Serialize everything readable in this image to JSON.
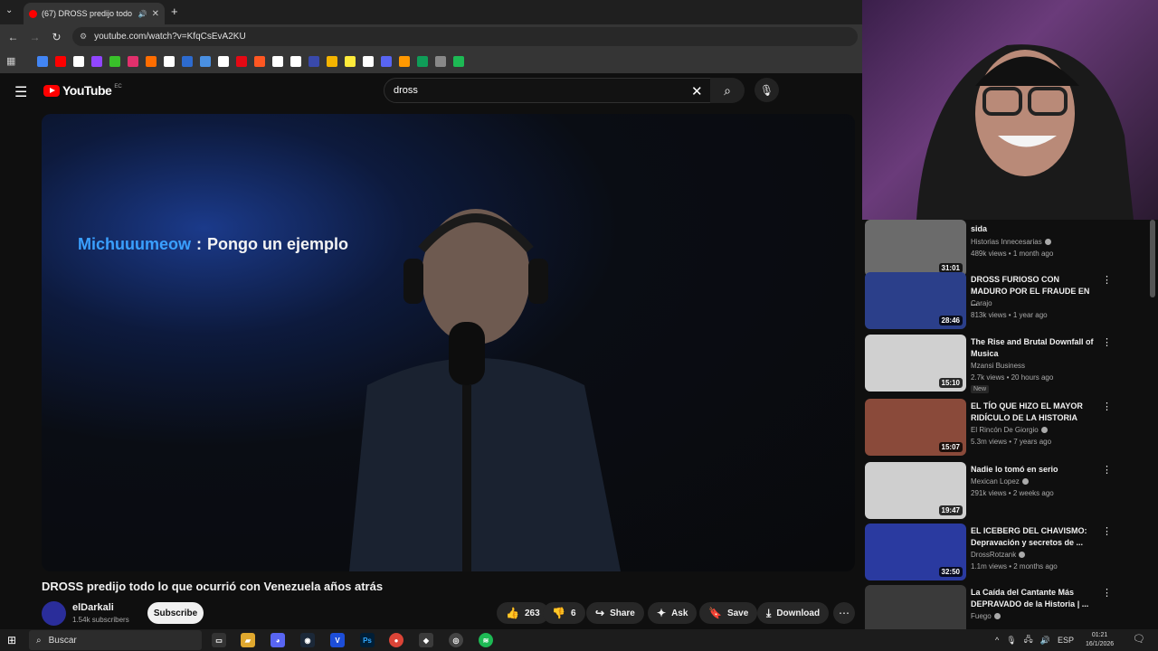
{
  "browser": {
    "tab_title": "(67) DROSS predijo todo lo",
    "url": "youtube.com/watch?v=KfqCsEvA2KU",
    "bookmark_colors": [
      "#4285f4",
      "#ff0000",
      "#ffffff",
      "#9146ff",
      "#39c02a",
      "#e1306c",
      "#ff6d00",
      "#ffffff",
      "#2d6bcf",
      "#4a90e2",
      "#ffffff",
      "#e50914",
      "#ff5722",
      "#ffffff",
      "#ffffff",
      "#3949ab",
      "#f4b400",
      "#ffeb3b",
      "#ffffff",
      "#5865f2",
      "#ff9800",
      "#0f9d58",
      "#888888",
      "#1db954"
    ]
  },
  "youtube": {
    "logo_text": "YouTube",
    "region": "EC",
    "search_query": "dross"
  },
  "video": {
    "chat_user": "Michuuumeow",
    "chat_sep": ":",
    "chat_message": "Pongo un ejemplo",
    "title": "DROSS predijo todo lo que ocurrió con Venezuela años atrás",
    "channel_name": "elDarkali",
    "subscribers": "1.54k subscribers",
    "subscribe_label": "Subscribe",
    "likes": "263",
    "dislikes": "6",
    "share_label": "Share",
    "ask_label": "Ask",
    "save_label": "Save",
    "download_label": "Download"
  },
  "recommendations": [
    {
      "title": "sida",
      "channel": "Historias Innecesarias",
      "verified": true,
      "views": "489k views",
      "age": "1 month ago",
      "duration": "31:01",
      "thumb": "#6b6b6b",
      "new": false
    },
    {
      "title": "DROSS FURIOSO CON MADURO POR EL FRAUDE EN ...",
      "channel": "Carajo",
      "verified": false,
      "views": "813k views",
      "age": "1 year ago",
      "duration": "28:46",
      "thumb": "#2b3f8a",
      "new": false
    },
    {
      "title": "The Rise and Brutal Downfall of Musica",
      "channel": "Mzansi Business",
      "verified": false,
      "views": "2.7k views",
      "age": "20 hours ago",
      "duration": "15:10",
      "thumb": "#d0d0d0",
      "new": true,
      "new_label": "New"
    },
    {
      "title": "EL TÍO QUE HIZO EL MAYOR RIDÍCULO DE LA HISTORIA",
      "channel": "El Rincón De Giorgio",
      "verified": true,
      "views": "5.3m views",
      "age": "7 years ago",
      "duration": "15:07",
      "thumb": "#8a4a3a",
      "new": false
    },
    {
      "title": "Nadie lo tomó en serio",
      "channel": "Mexican Lopez",
      "verified": true,
      "views": "291k views",
      "age": "2 weeks ago",
      "duration": "19:47",
      "thumb": "#cfcfcf",
      "new": false
    },
    {
      "title": "EL ICEBERG DEL CHAVISMO: Depravación y secretos de ...",
      "channel": "DrossRotzank",
      "verified": true,
      "views": "1.1m views",
      "age": "2 months ago",
      "duration": "32:50",
      "thumb": "#2a3aa0",
      "new": false
    },
    {
      "title": "La Caída del Cantante Más DEPRAVADO de la Historia | ...",
      "channel": "Fuego",
      "verified": true,
      "views": "",
      "age": "",
      "duration": "",
      "thumb": "#3a3a3a",
      "new": false
    }
  ],
  "taskbar": {
    "search_placeholder": "Buscar",
    "lang": "ESP",
    "time": "01:21",
    "date": "16/1/2026"
  }
}
